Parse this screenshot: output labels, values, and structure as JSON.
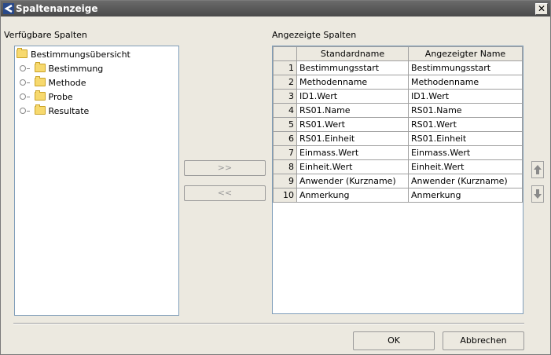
{
  "window": {
    "title": "Spaltenanzeige",
    "close_label": "✕"
  },
  "left_panel": {
    "label": "Verfügbare Spalten"
  },
  "tree": {
    "root": "Bestimmungsübersicht",
    "children": [
      "Bestimmung",
      "Methode",
      "Probe",
      "Resultate"
    ]
  },
  "transfer": {
    "add_label": ">>",
    "remove_label": "<<"
  },
  "right_panel": {
    "label": "Angezeigte Spalten"
  },
  "table": {
    "columns": [
      "",
      "Standardname",
      "Angezeigter Name"
    ],
    "rows": [
      {
        "n": "1",
        "std": "Bestimmungsstart",
        "shown": "Bestimmungsstart"
      },
      {
        "n": "2",
        "std": "Methodenname",
        "shown": "Methodenname"
      },
      {
        "n": "3",
        "std": "ID1.Wert",
        "shown": "ID1.Wert"
      },
      {
        "n": "4",
        "std": "RS01.Name",
        "shown": "RS01.Name"
      },
      {
        "n": "5",
        "std": "RS01.Wert",
        "shown": "RS01.Wert"
      },
      {
        "n": "6",
        "std": "RS01.Einheit",
        "shown": "RS01.Einheit"
      },
      {
        "n": "7",
        "std": "Einmass.Wert",
        "shown": "Einmass.Wert"
      },
      {
        "n": "8",
        "std": "Einheit.Wert",
        "shown": "Einheit.Wert"
      },
      {
        "n": "9",
        "std": "Anwender (Kurzname)",
        "shown": "Anwender (Kurzname)"
      },
      {
        "n": "10",
        "std": "Anmerkung",
        "shown": "Anmerkung"
      }
    ]
  },
  "footer": {
    "ok_label": "OK",
    "cancel_label": "Abbrechen"
  },
  "colors": {
    "titlebar": "#4a4a4a",
    "folder": "#f7d96e",
    "grid_border": "#7f9db9"
  }
}
